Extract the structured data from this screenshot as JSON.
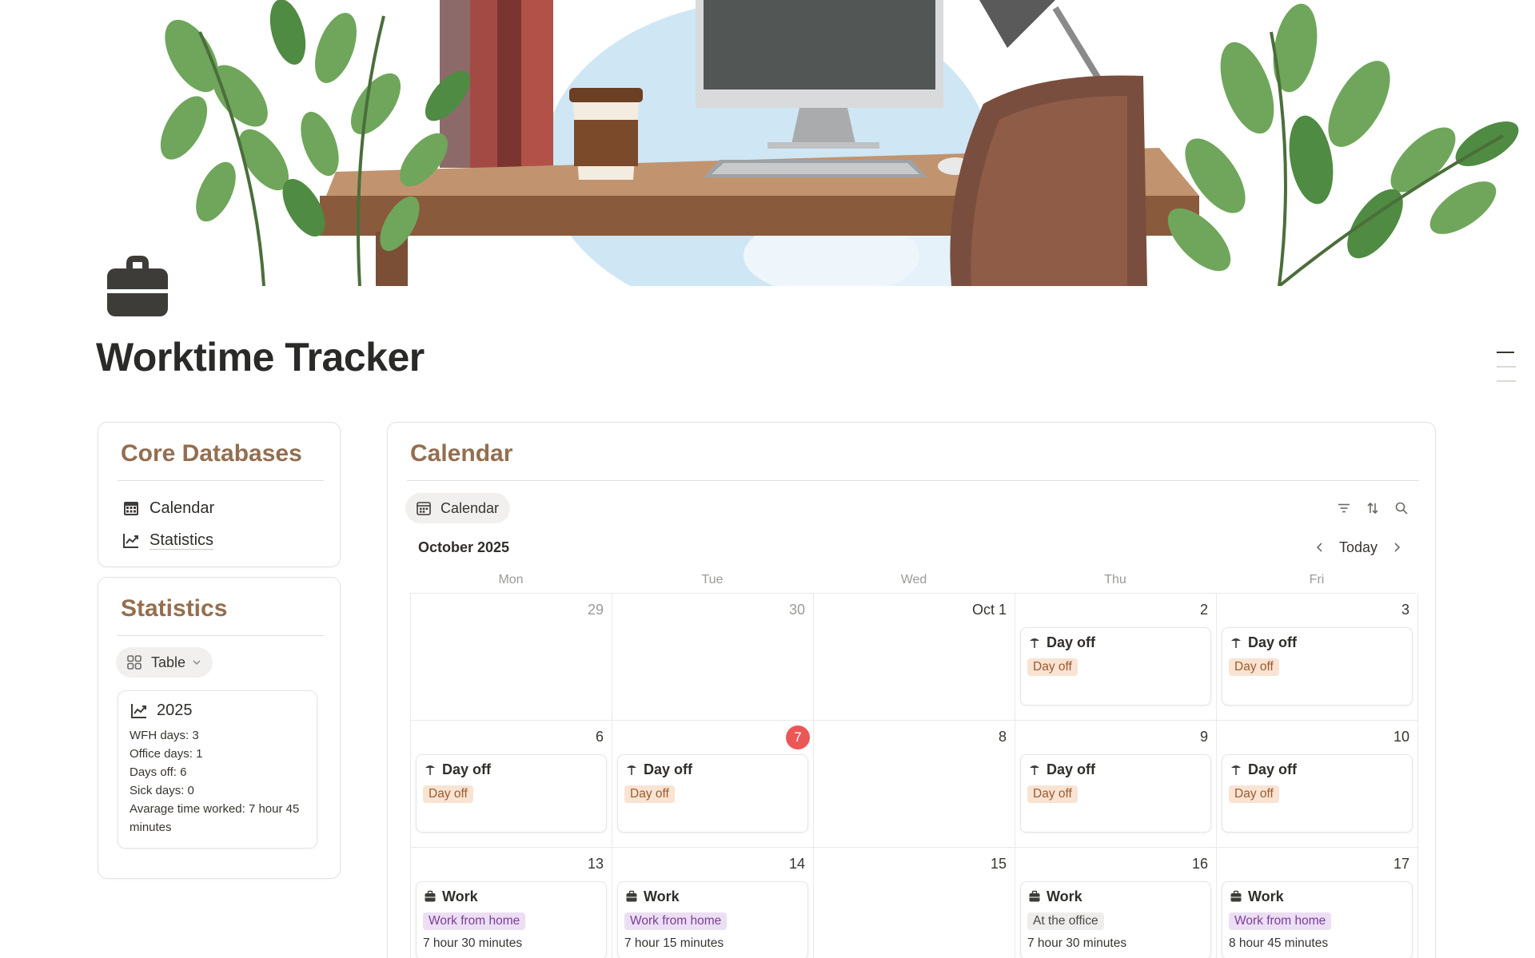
{
  "page": {
    "title": "Worktime Tracker"
  },
  "core_databases": {
    "title": "Core Databases",
    "items": [
      {
        "label": "Calendar",
        "icon": "calendar-grid-icon"
      },
      {
        "label": "Statistics",
        "icon": "chart-line-icon"
      }
    ]
  },
  "statistics": {
    "title": "Statistics",
    "view_label": "Table",
    "card": {
      "year": "2025",
      "lines": [
        "WFH days: 3",
        "Office days: 1",
        "Days off: 6",
        "Sick days: 0",
        "Avarage time worked: 7 hour 45 minutes"
      ]
    }
  },
  "calendar": {
    "title": "Calendar",
    "view_label": "Calendar",
    "month": "October 2025",
    "today_label": "Today",
    "weekdays": [
      "Mon",
      "Tue",
      "Wed",
      "Thu",
      "Fri"
    ],
    "weeks": [
      [
        {
          "date": "29",
          "muted": true
        },
        {
          "date": "30",
          "muted": true
        },
        {
          "date": "Oct 1"
        },
        {
          "date": "2",
          "event": {
            "title": "Day off",
            "tag": "Day off",
            "kind": "dayoff"
          }
        },
        {
          "date": "3",
          "event": {
            "title": "Day off",
            "tag": "Day off",
            "kind": "dayoff"
          }
        }
      ],
      [
        {
          "date": "6",
          "event": {
            "title": "Day off",
            "tag": "Day off",
            "kind": "dayoff"
          }
        },
        {
          "date": "7",
          "today": true,
          "event": {
            "title": "Day off",
            "tag": "Day off",
            "kind": "dayoff"
          }
        },
        {
          "date": "8"
        },
        {
          "date": "9",
          "event": {
            "title": "Day off",
            "tag": "Day off",
            "kind": "dayoff"
          }
        },
        {
          "date": "10",
          "event": {
            "title": "Day off",
            "tag": "Day off",
            "kind": "dayoff"
          }
        }
      ],
      [
        {
          "date": "13",
          "event": {
            "title": "Work",
            "tag": "Work from home",
            "kind": "wfh",
            "sub": "7 hour 30 minutes"
          }
        },
        {
          "date": "14",
          "event": {
            "title": "Work",
            "tag": "Work from home",
            "kind": "wfh",
            "sub": "7 hour 15 minutes"
          }
        },
        {
          "date": "15"
        },
        {
          "date": "16",
          "event": {
            "title": "Work",
            "tag": "At the office",
            "kind": "office",
            "sub": "7 hour 30 minutes"
          }
        },
        {
          "date": "17",
          "event": {
            "title": "Work",
            "tag": "Work from home",
            "kind": "wfh",
            "sub": "8 hour 45 minutes"
          }
        }
      ]
    ]
  },
  "colors": {
    "heading_brown": "#946e4f",
    "today_red": "#eb5757",
    "dayoff_tag_bg": "#f9e3d3",
    "wfh_tag_bg": "#ecdff4",
    "office_tag_bg": "#eeedeb"
  }
}
